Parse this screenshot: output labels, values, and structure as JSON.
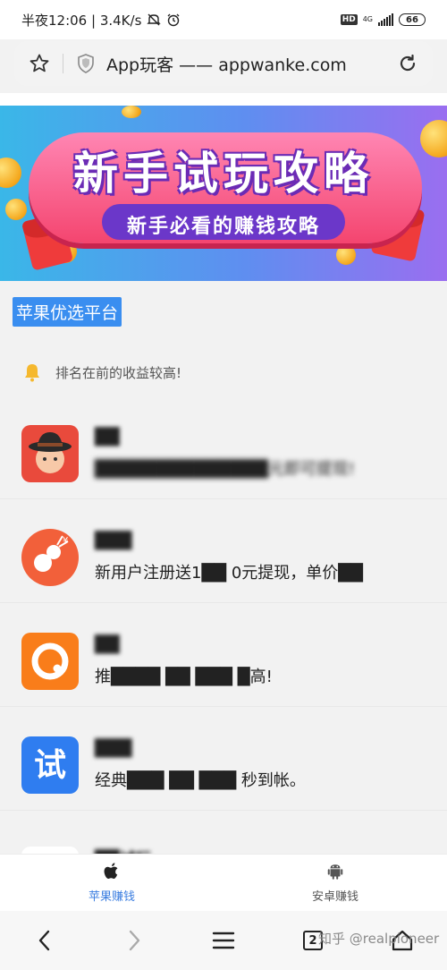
{
  "status_bar": {
    "time_speed": "半夜12:06 | 3.4K/s",
    "hd": "HD",
    "network": "4G",
    "battery": "66"
  },
  "url_bar": {
    "text": "App玩客 —— appwanke.com"
  },
  "banner": {
    "title": "新手试玩攻略",
    "subtitle": "新手必看的赚钱攻略"
  },
  "section_tag": "苹果优选平台",
  "notice": "排名在前的收益较高!",
  "apps": [
    {
      "name": "██",
      "desc": "██████████████元即可提现!"
    },
    {
      "name": "███",
      "desc": "新用户注册送1██ 0元提现，单价██"
    },
    {
      "name": "██",
      "desc": "推████ ██ ███ █高!"
    },
    {
      "name": "███",
      "desc": "经典███ ██ ███ 秒到帐。"
    },
    {
      "name": "██试玩",
      "desc": ""
    }
  ],
  "tabs": [
    {
      "label": "苹果赚钱",
      "icon": "apple-icon",
      "active": true
    },
    {
      "label": "安卓赚钱",
      "icon": "android-icon",
      "active": false
    }
  ],
  "nav": {
    "tab_count": "2"
  },
  "watermark": "知乎 @realpioneer",
  "colors": {
    "accent_blue": "#3a8ef0",
    "active_tab": "#3a7de0",
    "banner_pink": "#f4456f"
  }
}
